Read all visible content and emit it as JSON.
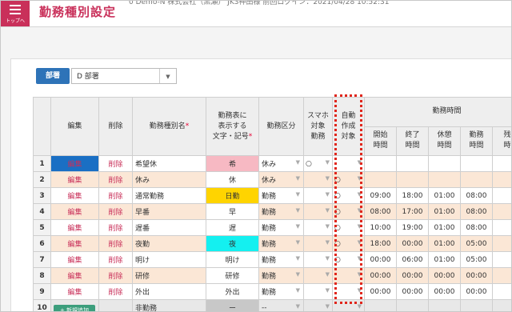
{
  "header": {
    "menu_label": "トップへ",
    "title": "勤務種別設定",
    "subtitle": "0 Demo-N 株式会社（黒瀬） JK3神田様 前回ログイン：2021/04/28 10:52:31"
  },
  "dept": {
    "button_label": "部署",
    "selected": "D 部署",
    "arrow": "▼"
  },
  "columns": {
    "edit": "編集",
    "delete": "削除",
    "name": "勤務種別名",
    "req": "*",
    "display_l1": "勤務表に",
    "display_l2": "表示する",
    "display_l3": "文字・記号",
    "category": "勤務区分",
    "phone_l1": "スマホ",
    "phone_l2": "対象",
    "phone_l3": "勤務",
    "auto_l1": "自動",
    "auto_l2": "作成",
    "auto_l3": "対象",
    "time_group": "勤務時間",
    "start_l1": "開始",
    "start_l2": "時間",
    "end_l1": "終了",
    "end_l2": "時間",
    "break_l1": "休憩",
    "break_l2": "時間",
    "work_l1": "勤務",
    "work_l2": "時間",
    "ot_l1": "残業",
    "ot_l2": "時間"
  },
  "colors": {
    "accent": "#c9305a",
    "primary_button": "#2e73b8",
    "edit_highlight": "#1a6fc4",
    "highlight_box": "#e0261c"
  },
  "rows": [
    {
      "no": "1",
      "edit": "編集",
      "del": "削除",
      "name": "希望休",
      "symbol": "希",
      "symbol_color": "#f7b9c3",
      "category": "休み",
      "phone": "○",
      "auto": "",
      "start": "",
      "end": "",
      "brk": "",
      "work": "",
      "ot": ""
    },
    {
      "no": "2",
      "edit": "編集",
      "del": "削除",
      "name": "休み",
      "symbol": "休",
      "symbol_color": "#ffffff",
      "category": "休み",
      "phone": "",
      "auto": "○",
      "start": "",
      "end": "",
      "brk": "",
      "work": "",
      "ot": ""
    },
    {
      "no": "3",
      "edit": "編集",
      "del": "削除",
      "name": "通常勤務",
      "symbol": "日勤",
      "symbol_color": "#ffd400",
      "category": "勤務",
      "phone": "",
      "auto": "○",
      "start": "09:00",
      "end": "18:00",
      "brk": "01:00",
      "work": "08:00",
      "ot": ""
    },
    {
      "no": "4",
      "edit": "編集",
      "del": "削除",
      "name": "早番",
      "symbol": "早",
      "symbol_color": "#ffffff",
      "category": "勤務",
      "phone": "",
      "auto": "○",
      "start": "08:00",
      "end": "17:00",
      "brk": "01:00",
      "work": "08:00",
      "ot": ""
    },
    {
      "no": "5",
      "edit": "編集",
      "del": "削除",
      "name": "遅番",
      "symbol": "遅",
      "symbol_color": "#ffffff",
      "category": "勤務",
      "phone": "",
      "auto": "○",
      "start": "10:00",
      "end": "19:00",
      "brk": "01:00",
      "work": "08:00",
      "ot": ""
    },
    {
      "no": "6",
      "edit": "編集",
      "del": "削除",
      "name": "夜勤",
      "symbol": "夜",
      "symbol_color": "#14f0f0",
      "category": "勤務",
      "phone": "",
      "auto": "○",
      "start": "18:00",
      "end": "00:00",
      "brk": "01:00",
      "work": "05:00",
      "ot": ""
    },
    {
      "no": "7",
      "edit": "編集",
      "del": "削除",
      "name": "明け",
      "symbol": "明け",
      "symbol_color": "#ffffff",
      "category": "勤務",
      "phone": "",
      "auto": "○",
      "start": "00:00",
      "end": "06:00",
      "brk": "01:00",
      "work": "05:00",
      "ot": ""
    },
    {
      "no": "8",
      "edit": "編集",
      "del": "削除",
      "name": "研修",
      "symbol": "研修",
      "symbol_color": "#ffffff",
      "category": "勤務",
      "phone": "",
      "auto": "",
      "start": "00:00",
      "end": "00:00",
      "brk": "00:00",
      "work": "00:00",
      "ot": ""
    },
    {
      "no": "9",
      "edit": "編集",
      "del": "削除",
      "name": "外出",
      "symbol": "外出",
      "symbol_color": "#ffffff",
      "category": "勤務",
      "phone": "",
      "auto": "",
      "start": "00:00",
      "end": "00:00",
      "brk": "00:00",
      "work": "00:00",
      "ot": ""
    },
    {
      "no": "10",
      "edit": "",
      "del": "",
      "name": "非勤務",
      "symbol": "ー",
      "symbol_color": "#c8c8c8",
      "category": "--",
      "phone": "",
      "auto": "",
      "start": "",
      "end": "",
      "brk": "",
      "work": "",
      "ot": ""
    }
  ],
  "footer": {
    "add_label": "+ 新規追加"
  }
}
